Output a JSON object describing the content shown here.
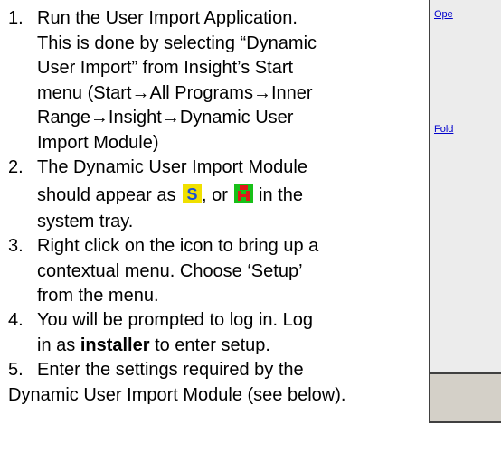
{
  "steps": [
    {
      "number": "1.",
      "lines": [
        "Run the User Import Application.",
        "This is done by selecting “Dynamic",
        "User Import” from Insight’s Start",
        "menu (Start→All Programs→Inner",
        "Range→Insight→Dynamic User",
        "Import Module)"
      ]
    },
    {
      "number": "2.",
      "line1": "The Dynamic User Import Module",
      "line2_before": "should appear as ",
      "line2_middle": ", or ",
      "line2_after": " in the",
      "line3": "system tray.",
      "icons": [
        "s-tray-icon",
        "ip-tray-icon"
      ]
    },
    {
      "number": "3.",
      "lines": [
        "Right click on the icon to bring up a",
        "contextual menu.  Choose ‘Setup’",
        "from the menu."
      ]
    },
    {
      "number": "4.",
      "line1": "You will be prompted to log in.  Log",
      "line2_before": "in as ",
      "line2_bold": "installer",
      "line2_after": " to enter setup."
    },
    {
      "number": "5.",
      "lines": [
        "Enter the settings required by the",
        "Dynamic User Import Module (see below)."
      ]
    }
  ],
  "dialog": {
    "link1": "Ope",
    "link2": "Fold"
  },
  "colors": {
    "s_icon_bg": "#f0e000",
    "s_icon_fg": "#1a4fd6",
    "ip_icon_bg": "#18c018",
    "ip_icon_fg": "#e01818",
    "dialog_bg": "#d4d0c8",
    "link": "#0000cc"
  }
}
